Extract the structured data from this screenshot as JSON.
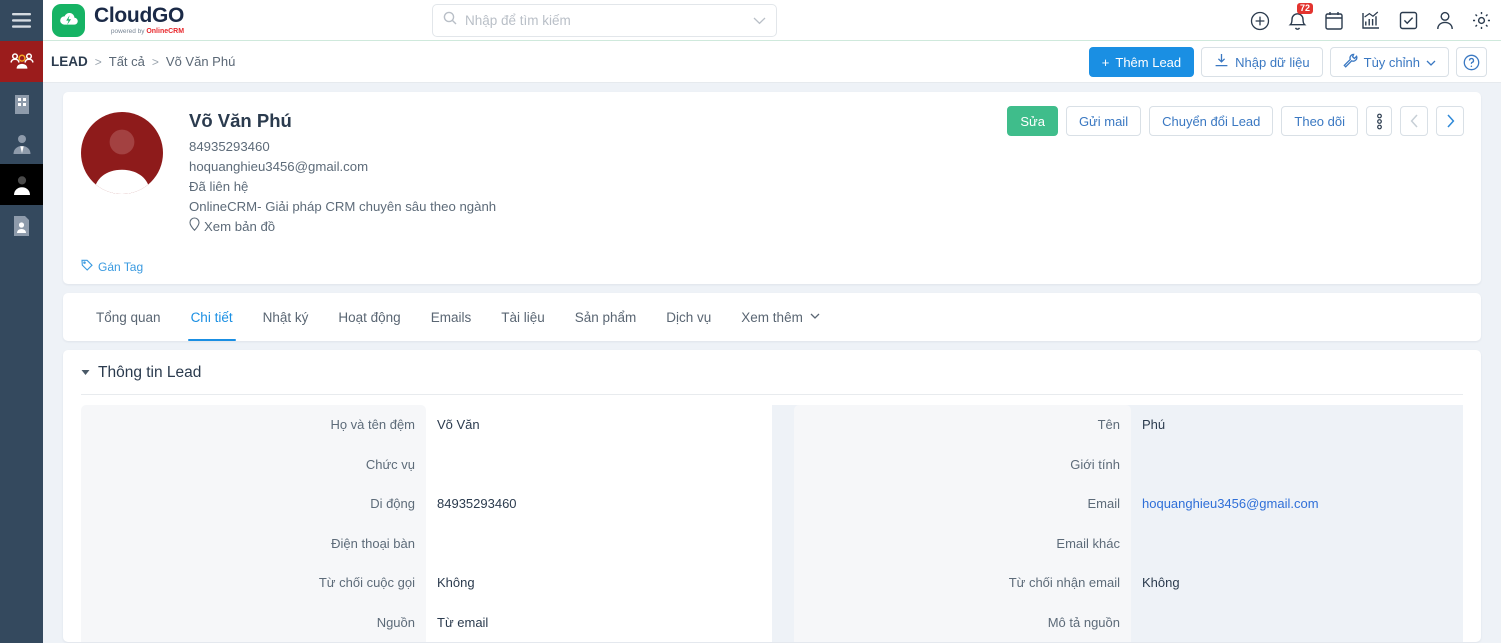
{
  "sidebar": {
    "items": [
      {
        "name": "menu-toggle",
        "icon": "hamburger-icon",
        "state": "default"
      },
      {
        "name": "contacts-group",
        "icon": "people-group-icon",
        "state": "active-red"
      },
      {
        "name": "company",
        "icon": "building-icon",
        "state": "default"
      },
      {
        "name": "customer",
        "icon": "person-tie-icon",
        "state": "default"
      },
      {
        "name": "lead",
        "icon": "person-icon",
        "state": "active-dark"
      },
      {
        "name": "document",
        "icon": "document-person-icon",
        "state": "default"
      }
    ]
  },
  "header": {
    "logo": {
      "title": "CloudGO",
      "powered_prefix": "powered by ",
      "powered_brand": "OnlineCRM"
    },
    "search": {
      "placeholder": "Nhập để tìm kiếm",
      "value": ""
    },
    "icons": [
      {
        "name": "add-circle-icon",
        "badge": ""
      },
      {
        "name": "bell-icon",
        "badge": "72"
      },
      {
        "name": "calendar-icon",
        "badge": ""
      },
      {
        "name": "chart-icon",
        "badge": ""
      },
      {
        "name": "task-check-icon",
        "badge": ""
      },
      {
        "name": "user-icon",
        "badge": ""
      },
      {
        "name": "gear-icon",
        "badge": ""
      }
    ]
  },
  "breadcrumb": {
    "root": "LEAD",
    "sep1": ">",
    "mid": "Tất cả",
    "sep2": ">",
    "current": "Võ Văn Phú"
  },
  "page_actions": {
    "add_lead": "Thêm Lead",
    "add_lead_plus": "+",
    "import": "Nhập dữ liệu",
    "customize": "Tùy chỉnh",
    "help": "?"
  },
  "profile": {
    "name": "Võ Văn Phú",
    "phone": "84935293460",
    "email": "hoquanghieu3456@gmail.com",
    "status": "Đã liên hệ",
    "company": "OnlineCRM- Giải pháp CRM chuyên sâu theo ngành",
    "map_link": "Xem bản đồ",
    "tag_link": "Gán Tag",
    "actions": {
      "edit": "Sửa",
      "send_mail": "Gửi mail",
      "convert": "Chuyển đổi Lead",
      "follow": "Theo dõi"
    }
  },
  "tabs": [
    {
      "label": "Tổng quan",
      "active": false
    },
    {
      "label": "Chi tiết",
      "active": true
    },
    {
      "label": "Nhật ký",
      "active": false
    },
    {
      "label": "Hoạt động",
      "active": false
    },
    {
      "label": "Emails",
      "active": false
    },
    {
      "label": "Tài liệu",
      "active": false
    },
    {
      "label": "Sản phẩm",
      "active": false
    },
    {
      "label": "Dịch vụ",
      "active": false
    },
    {
      "label": "Xem thêm",
      "active": false,
      "chevron": true
    }
  ],
  "section": {
    "title": "Thông tin Lead",
    "left_fields": [
      {
        "label": "Họ và tên đệm",
        "value": "Võ Văn",
        "link": false
      },
      {
        "label": "Chức vụ",
        "value": "",
        "link": false
      },
      {
        "label": "Di động",
        "value": "84935293460",
        "link": false
      },
      {
        "label": "Điện thoại bàn",
        "value": "",
        "link": false
      },
      {
        "label": "Từ chối cuộc gọi",
        "value": "Không",
        "link": false
      },
      {
        "label": "Nguồn",
        "value": "Từ email",
        "link": false
      }
    ],
    "right_fields": [
      {
        "label": "Tên",
        "value": "Phú",
        "link": false
      },
      {
        "label": "Giới tính",
        "value": "",
        "link": false
      },
      {
        "label": "Email",
        "value": "hoquanghieu3456@gmail.com",
        "link": true
      },
      {
        "label": "Email khác",
        "value": "",
        "link": false
      },
      {
        "label": "Từ chối nhận email",
        "value": "Không",
        "link": false
      },
      {
        "label": "Mô tả nguồn",
        "value": "",
        "link": false
      }
    ]
  },
  "colors": {
    "brand_green": "#16b364",
    "primary_blue": "#1a8fe3",
    "edit_green": "#3fbd8b",
    "avatar_red": "#8e1b1b",
    "rail_dark": "#34495e",
    "rail_active_red": "#9b1c1c",
    "badge_red": "#e3342f",
    "label_bg": "#f6f7f9",
    "page_bg": "#eef2f7"
  }
}
